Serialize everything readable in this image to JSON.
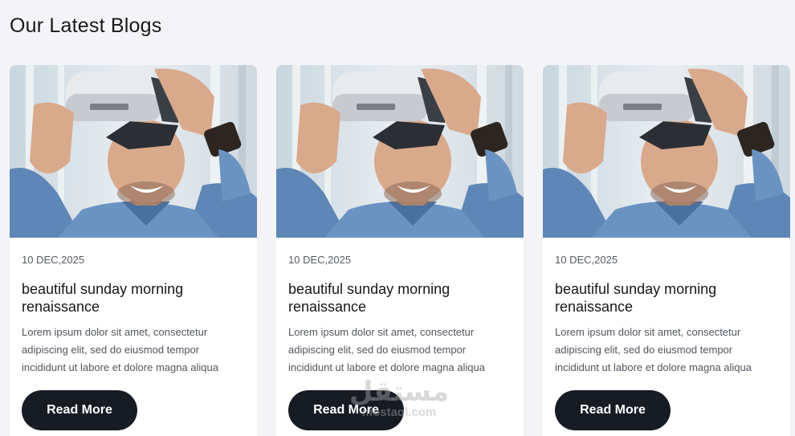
{
  "section": {
    "title": "Our Latest Blogs"
  },
  "cards": [
    {
      "image_alt": "Smiling man wearing a VR headset",
      "date": "10 DEC,2025",
      "title": "beautiful sunday morning renaissance",
      "excerpt": "Lorem ipsum dolor sit amet, consectetur adipiscing elit, sed do eiusmod tempor incididunt ut labore et dolore magna aliqua",
      "button_label": "Read More"
    },
    {
      "image_alt": "Smiling man wearing a VR headset",
      "date": "10 DEC,2025",
      "title": "beautiful sunday morning renaissance",
      "excerpt": "Lorem ipsum dolor sit amet, consectetur adipiscing elit, sed do eiusmod tempor incididunt ut labore et dolore magna aliqua",
      "button_label": "Read More"
    },
    {
      "image_alt": "Smiling man wearing a VR headset",
      "date": "10 DEC,2025",
      "title": "beautiful sunday morning renaissance",
      "excerpt": "Lorem ipsum dolor sit amet, consectetur adipiscing elit, sed do eiusmod tempor incididunt ut labore et dolore magna aliqua",
      "button_label": "Read More"
    }
  ],
  "watermark": {
    "main": "مستقل",
    "sub": "mostaql.com"
  },
  "colors": {
    "background": "#f4f4f7",
    "card": "#ffffff",
    "button": "#161b24",
    "button_text": "#ffffff",
    "heading": "#17191d",
    "body_text": "#50555e"
  }
}
